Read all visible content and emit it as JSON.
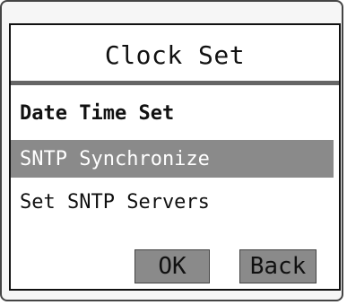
{
  "dialog": {
    "title": "Clock Set",
    "items": [
      {
        "label": "Date Time Set",
        "state": "focused-bold"
      },
      {
        "label": "SNTP Synchronize",
        "state": "highlighted"
      },
      {
        "label": "Set SNTP Servers",
        "state": "normal"
      }
    ],
    "ok_label": "OK",
    "back_label": "Back"
  },
  "colors": {
    "highlight": "#8a8a8a",
    "border": "#111111",
    "separator": "#666666",
    "background": "#ffffff"
  }
}
